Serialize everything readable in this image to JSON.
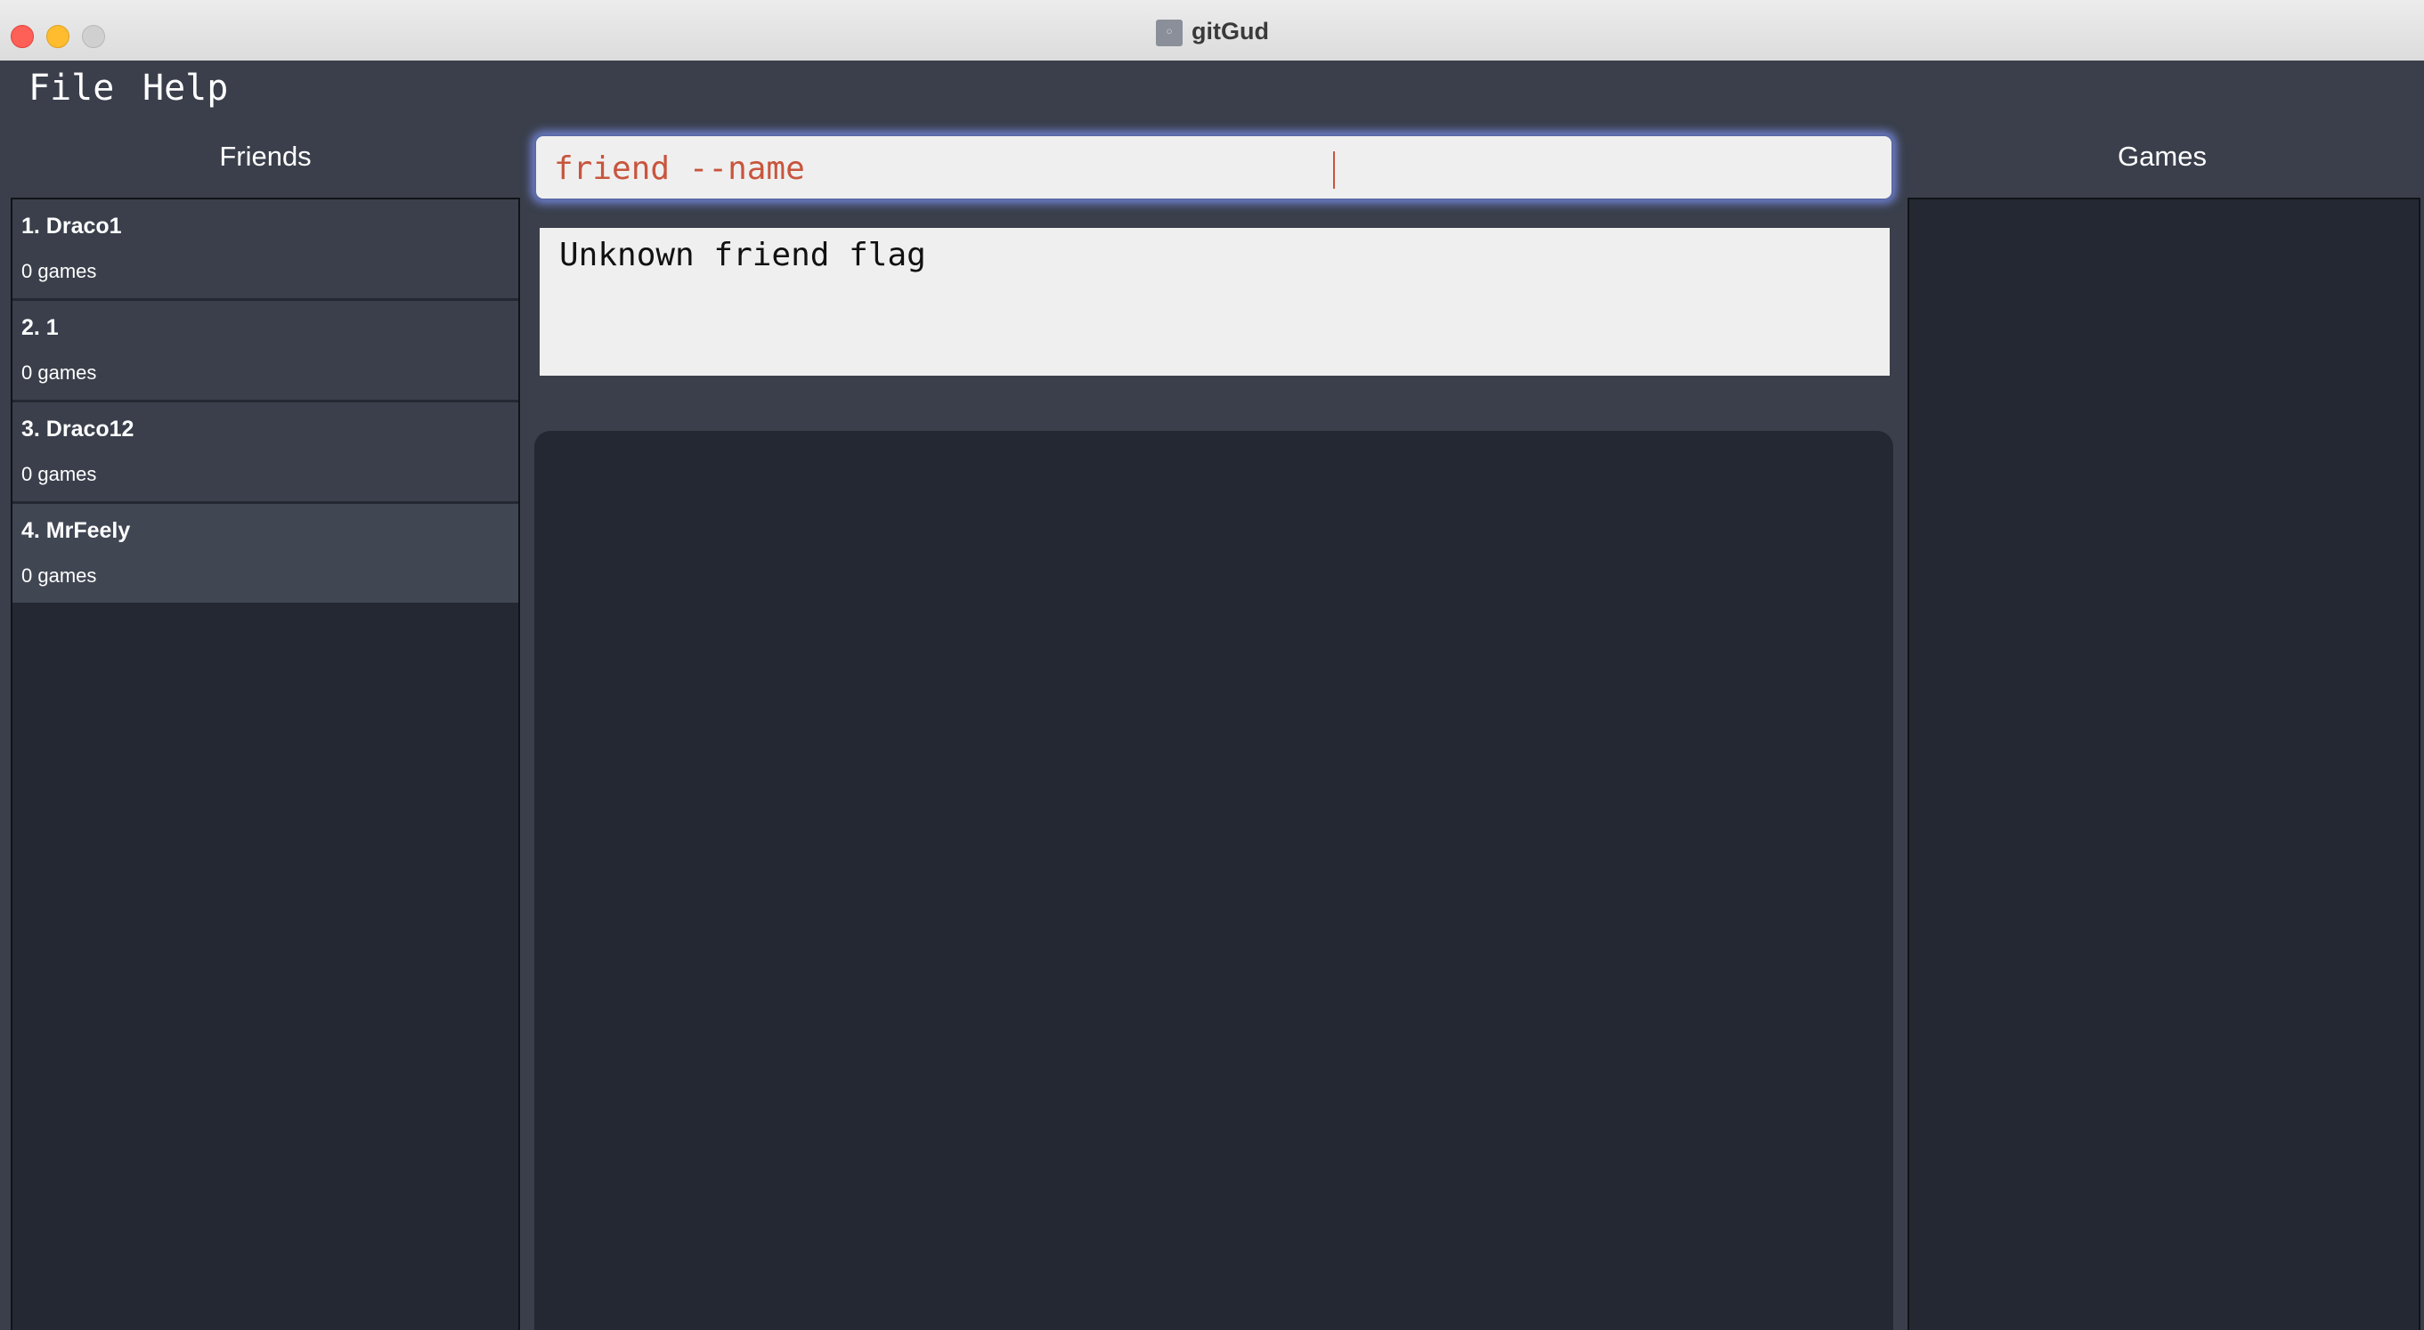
{
  "window": {
    "title": "gitGud",
    "app_icon": "app-icon"
  },
  "menu": {
    "file_label": "File",
    "help_label": "Help"
  },
  "friends_panel": {
    "title": "Friends",
    "items": [
      {
        "name": "1. Draco1",
        "games": "0 games"
      },
      {
        "name": "2. 1",
        "games": "0 games"
      },
      {
        "name": "3. Draco12",
        "games": "0 games"
      },
      {
        "name": "4. MrFeely",
        "games": "0 games"
      }
    ]
  },
  "games_panel": {
    "title": "Games",
    "items": []
  },
  "command": {
    "value": "friend --name"
  },
  "result": {
    "text": "Unknown friend flag"
  },
  "colors": {
    "background": "#3a3f4b",
    "list_background": "#232833",
    "command_text": "#c8553d",
    "focus_glow": "#7a8ce6"
  }
}
